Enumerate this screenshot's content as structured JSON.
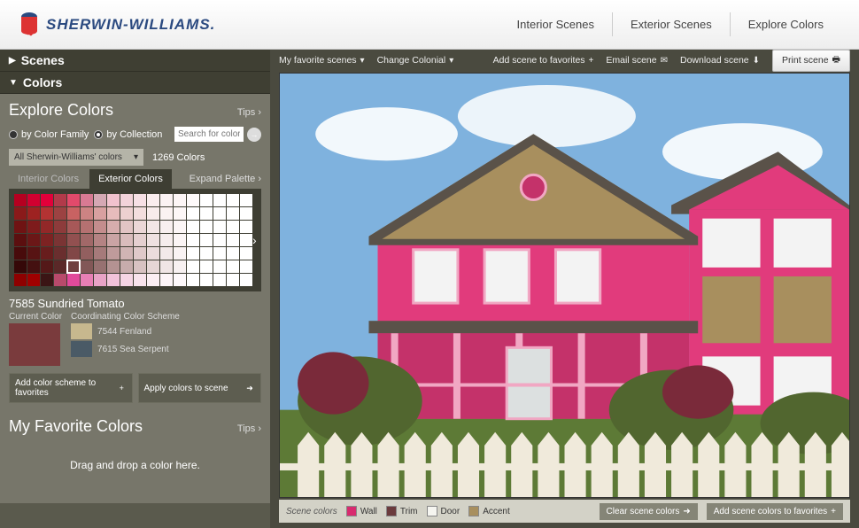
{
  "brand": "SHERWIN-WILLIAMS.",
  "top_nav": [
    "Interior Scenes",
    "Exterior Scenes",
    "Explore Colors"
  ],
  "sidebar": {
    "scenes_header": "Scenes",
    "colors_header": "Colors",
    "explore_title": "Explore Colors",
    "tips": "Tips ›",
    "filter": {
      "by_family": "by Color Family",
      "by_collection": "by Collection",
      "search_placeholder": "Search for color"
    },
    "dropdown_label": "All Sherwin-Williams' colors",
    "count": "1269 Colors",
    "tabs": {
      "interior": "Interior Colors",
      "exterior": "Exterior Colors",
      "expand": "Expand Palette ›"
    },
    "selected_color": {
      "code_name": "7585 Sundried Tomato",
      "hex": "#7a3b3d"
    },
    "current_label": "Current Color",
    "coord_label": "Coordinating Color Scheme",
    "coord": [
      {
        "name": "7544 Fenland",
        "hex": "#c7b88e"
      },
      {
        "name": "7615 Sea Serpent",
        "hex": "#4a5a66"
      }
    ],
    "btn_add_scheme": "Add color scheme to favorites",
    "btn_apply": "Apply colors to scene",
    "fav_title": "My Favorite Colors",
    "drag_hint": "Drag and drop a color here."
  },
  "palette_rows": [
    [
      "#b50020",
      "#d10030",
      "#e3003a",
      "#b23a4a",
      "#e24a6b",
      "#d87a93",
      "#d5a8b4",
      "#f1c2ce",
      "#f3d3da",
      "#f7e0e5",
      "#faedee",
      "#fbf2f3",
      "#fdf6f6",
      "#fefafa",
      "#fff",
      "#fff",
      "#fff",
      "#fff"
    ],
    [
      "#8a1a1a",
      "#9e2221",
      "#b33333",
      "#9c4242",
      "#c86262",
      "#cc8383",
      "#d8a0a0",
      "#e7bcbc",
      "#edd0d0",
      "#f3dede",
      "#f8ecec",
      "#fbf2f2",
      "#fdf7f7",
      "#fff",
      "#fff",
      "#fff",
      "#fff",
      "#fff"
    ],
    [
      "#6f1313",
      "#7e1b1c",
      "#922828",
      "#8d3b3b",
      "#a75858",
      "#b57171",
      "#c48d8d",
      "#d7adad",
      "#e2c4c4",
      "#ecd7d7",
      "#f3e6e6",
      "#f8efef",
      "#fcf6f6",
      "#fff",
      "#fff",
      "#fff",
      "#fff",
      "#fff"
    ],
    [
      "#5b0f0f",
      "#6b1717",
      "#7d2222",
      "#7a3434",
      "#925050",
      "#a16868",
      "#b48383",
      "#caa4a4",
      "#d9bcbc",
      "#e5d0d0",
      "#efe1e1",
      "#f6eded",
      "#fbf5f5",
      "#fff",
      "#fff",
      "#fff",
      "#fff",
      "#fff"
    ],
    [
      "#480b0b",
      "#571313",
      "#681d1d",
      "#6a2e2e",
      "#814747",
      "#925f5f",
      "#a67a7a",
      "#bf9b9b",
      "#d0b4b4",
      "#dfc9c9",
      "#ebdcdc",
      "#f3e9e9",
      "#f9f3f3",
      "#fff",
      "#fff",
      "#fff",
      "#fff",
      "#fff"
    ],
    [
      "#350808",
      "#441010",
      "#541818",
      "#5a2828",
      "#704040",
      "#825757",
      "#977171",
      "#b49292",
      "#c7acac",
      "#d8c2c2",
      "#e6d6d6",
      "#f0e5e5",
      "#f8f1f1",
      "#fff",
      "#fff",
      "#fff",
      "#fff",
      "#fff"
    ],
    [
      "#8e0000",
      "#a00000",
      "#3b1515",
      "#b84a6b",
      "#e24a9b",
      "#e87fb5",
      "#e9a3c7",
      "#f2c2da",
      "#f5d5e4",
      "#f8e3ec",
      "#fbeef3",
      "#fdf5f8",
      "#fef9fb",
      "#fff",
      "#fff",
      "#fff",
      "#fff",
      "#fff"
    ]
  ],
  "selected_swatch_row": 5,
  "selected_swatch_col": 4,
  "toolbar": {
    "fav_scenes": "My favorite scenes",
    "change": "Change Colonial",
    "add_fav": "Add scene to favorites",
    "email": "Email scene",
    "download": "Download scene",
    "print": "Print scene"
  },
  "scene_bar": {
    "label": "Scene colors",
    "items": [
      {
        "label": "Wall",
        "hex": "#d82b6f"
      },
      {
        "label": "Trim",
        "hex": "#6b3b3d"
      },
      {
        "label": "Door",
        "hex": "#f5f5f0"
      },
      {
        "label": "Accent",
        "hex": "#a88f5e"
      }
    ],
    "clear": "Clear scene colors",
    "add_fav": "Add scene colors to favorites"
  },
  "house_colors": {
    "sky": "#7fb2de",
    "wall": "#e13b7c",
    "wall_shadow": "#c4326a",
    "trim": "#f1a7c3",
    "shingle": "#a88f5e",
    "door": "#dce0e0",
    "roof": "#5a5249",
    "bush": "#51662f",
    "fence": "#f0eadb",
    "grass": "#5d7a36"
  }
}
